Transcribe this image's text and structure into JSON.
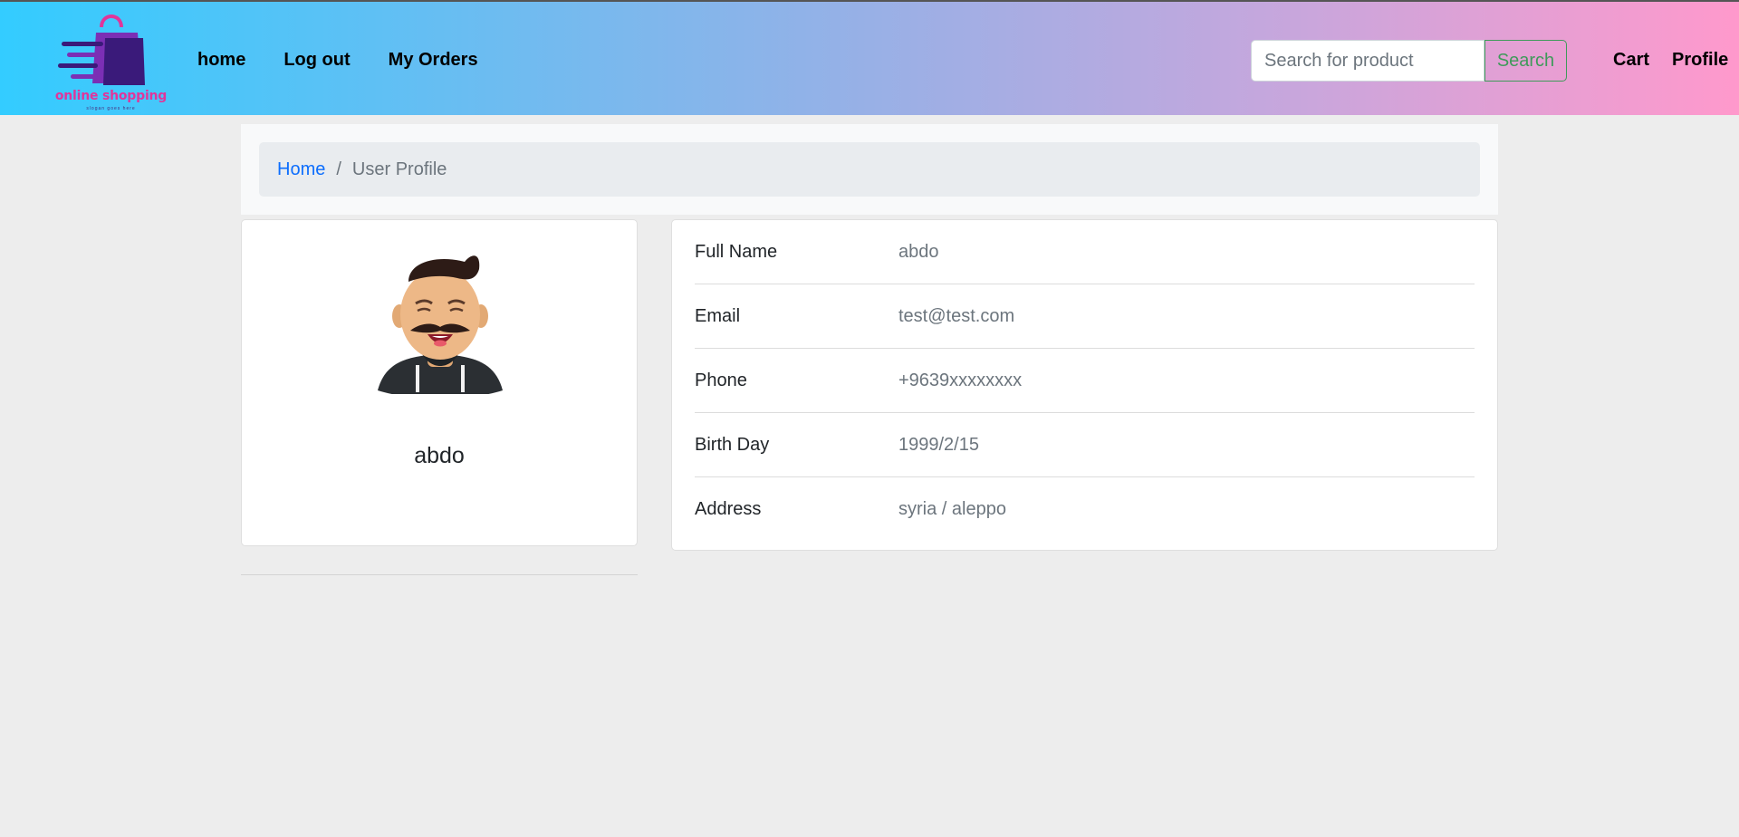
{
  "navbar": {
    "logo": {
      "text": "online shopping",
      "subtext": "slogan goes here"
    },
    "links": [
      {
        "label": "home"
      },
      {
        "label": "Log out"
      },
      {
        "label": "My Orders"
      }
    ],
    "search": {
      "placeholder": "Search for product",
      "value": "",
      "button_label": "Search"
    },
    "right_links": [
      {
        "label": "Cart"
      },
      {
        "label": "Profile"
      }
    ],
    "colors": {
      "gradient_start": "#33ccff",
      "gradient_end": "#ff99cc",
      "search_button": "#3f9a5a"
    }
  },
  "breadcrumb": {
    "home_label": "Home",
    "separator": "/",
    "current_label": "User Profile"
  },
  "profile": {
    "name": "abdo",
    "avatar_icon": "cartoon-man-mustache-avatar"
  },
  "details": [
    {
      "label": "Full Name",
      "value": "abdo"
    },
    {
      "label": "Email",
      "value": "test@test.com"
    },
    {
      "label": "Phone",
      "value": "+9639xxxxxxxx"
    },
    {
      "label": "Birth Day",
      "value": "1999/2/15"
    },
    {
      "label": "Address",
      "value": "syria / aleppo"
    }
  ]
}
